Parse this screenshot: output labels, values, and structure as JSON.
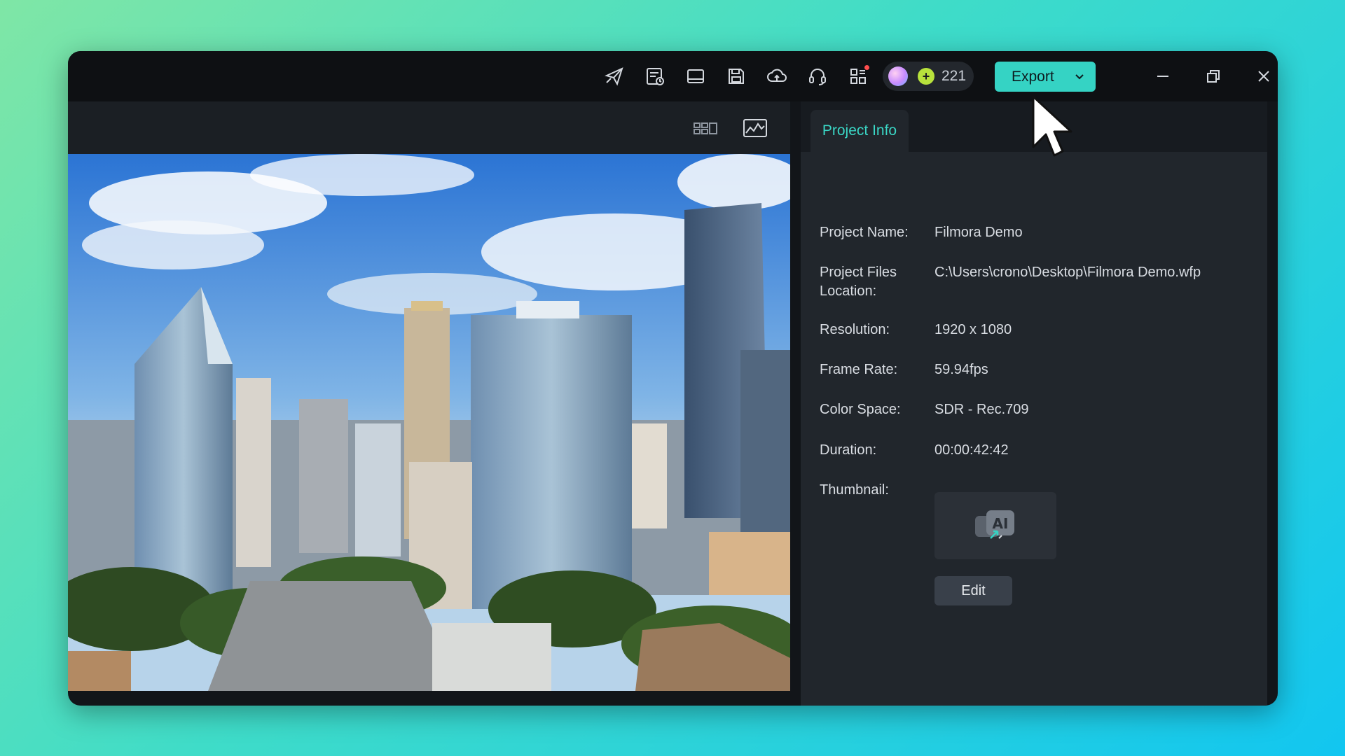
{
  "toolbar": {
    "icons": [
      "share-icon",
      "task-list-icon",
      "layout-icon",
      "save-icon",
      "cloud-upload-icon",
      "support-headset-icon",
      "apps-grid-icon"
    ],
    "credits": "221",
    "export_label": "Export"
  },
  "preview": {
    "toolbar_icons": [
      "grid-view-icon",
      "waveform-scope-icon"
    ]
  },
  "panel": {
    "tab_label": "Project Info",
    "project_name_label": "Project Name:",
    "project_name_value": "Filmora Demo",
    "files_location_label_line1": "Project Files",
    "files_location_label_line2": "Location:",
    "files_location_value": "C:\\Users\\crono\\Desktop\\Filmora Demo.wfp",
    "resolution_label": "Resolution:",
    "resolution_value": "1920 x 1080",
    "frame_rate_label": "Frame Rate:",
    "frame_rate_value": "59.94fps",
    "color_space_label": "Color Space:",
    "color_space_value": "SDR - Rec.709",
    "duration_label": "Duration:",
    "duration_value": "00:00:42:42",
    "thumbnail_label": "Thumbnail:",
    "edit_label": "Edit"
  },
  "colors": {
    "accent": "#35d3c4",
    "tab_text": "#3ad6c5",
    "panel_bg": "#21262c",
    "titlebar_bg": "#0e1013"
  }
}
